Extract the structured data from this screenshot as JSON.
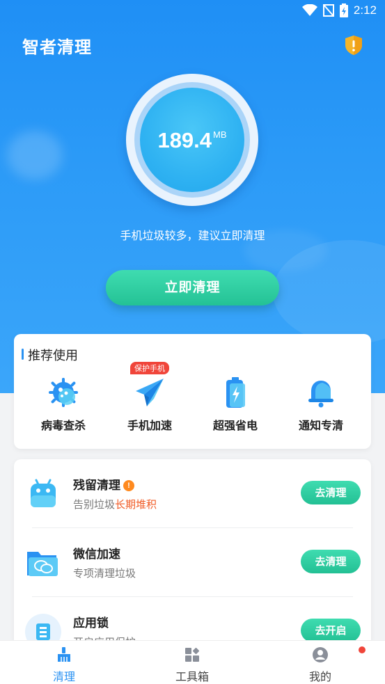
{
  "status_bar": {
    "time": "2:12"
  },
  "header": {
    "title": "智者清理"
  },
  "gauge": {
    "value": "189.4",
    "unit": "MB"
  },
  "hint": "手机垃圾较多，建议立即清理",
  "clean_button": "立即清理",
  "recommend": {
    "title": "推荐使用",
    "items": [
      {
        "label": "病毒查杀",
        "icon": "virus-icon"
      },
      {
        "label": "手机加速",
        "icon": "paper-plane-icon",
        "tag": "保护手机"
      },
      {
        "label": "超强省电",
        "icon": "battery-icon"
      },
      {
        "label": "通知专清",
        "icon": "bell-icon"
      }
    ]
  },
  "features": [
    {
      "title": "残留清理",
      "desc": "告别垃圾",
      "desc_highlight": "长期堆积",
      "action": "去清理",
      "icon": "android-robot-icon",
      "badge": "!"
    },
    {
      "title": "微信加速",
      "desc": "专项清理垃圾",
      "action": "去清理",
      "icon": "wechat-folder-icon"
    },
    {
      "title": "应用锁",
      "desc": "开启应用保护",
      "action": "去开启",
      "icon": "app-lock-icon"
    }
  ],
  "tabs": [
    {
      "label": "清理",
      "active": true,
      "icon": "broom-icon"
    },
    {
      "label": "工具箱",
      "active": false,
      "icon": "grid-icon"
    },
    {
      "label": "我的",
      "active": false,
      "icon": "user-icon"
    }
  ],
  "colors": {
    "primary": "#2a92f2",
    "accent_green": "#2ccf9f",
    "highlight": "#f05a24"
  }
}
